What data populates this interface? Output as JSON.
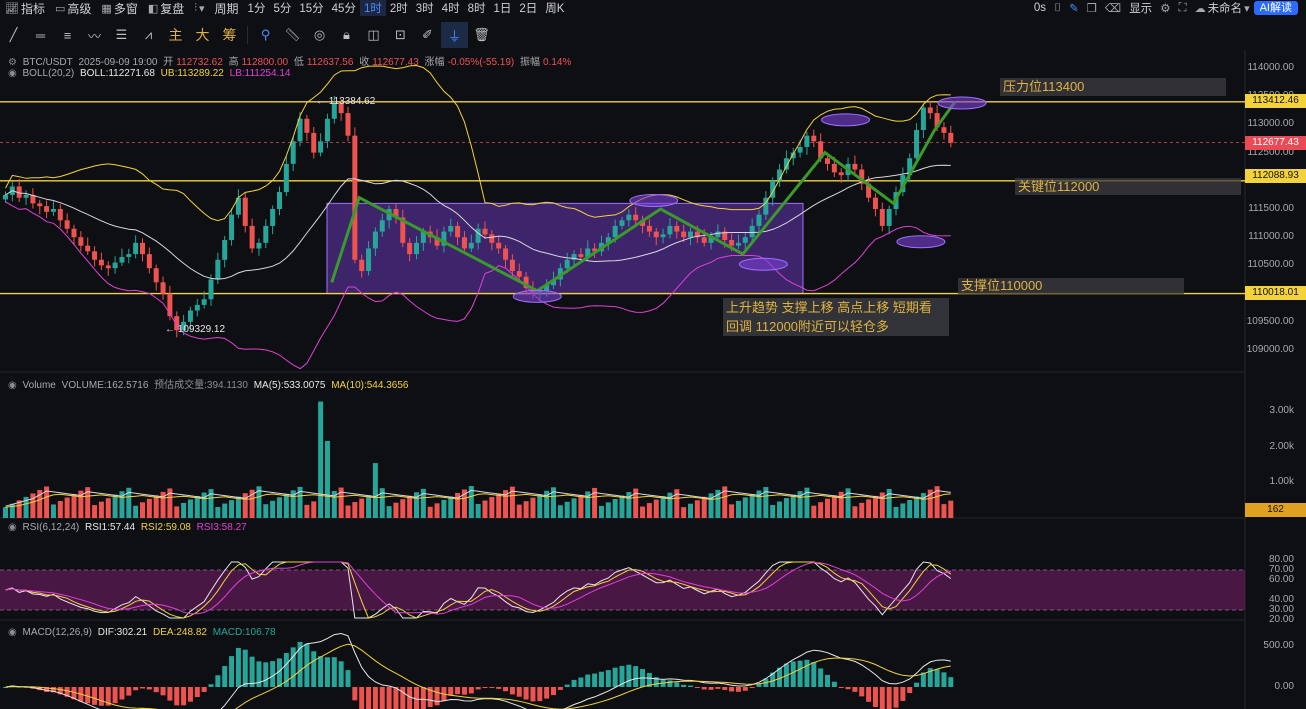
{
  "toolbar": {
    "indicators": "指标",
    "advanced": "高级",
    "multi_window": "多窗",
    "replay": "复盘",
    "period": "周期",
    "timeframes": [
      "1分",
      "5分",
      "15分",
      "45分",
      "1时",
      "2时",
      "3时",
      "4时",
      "8时",
      "1日",
      "2日",
      "周K"
    ],
    "active_timeframe": "1时",
    "countdown": "0s",
    "display": "显示",
    "layout_name": "未命名",
    "ai_button": "AI解读"
  },
  "draw_tools": [
    "主",
    "大",
    "筹"
  ],
  "info": {
    "symbol": "BTC/USDT",
    "datetime": "2025-09-09 19:00",
    "open_label": "开",
    "open": "112732.62",
    "high_label": "高",
    "high": "112800.00",
    "low_label": "低",
    "low": "112637.56",
    "close_label": "收",
    "close": "112677.43",
    "change_label": "涨幅",
    "change": "-0.05%(-55.19)",
    "amp_label": "振幅",
    "amp": "0.14%"
  },
  "boll": {
    "name": "BOLL(20,2)",
    "mid": "BOLL:112271.68",
    "ub": "UB:113289.22",
    "lb": "LB:111254.14"
  },
  "volume": {
    "name": "Volume",
    "vol": "VOLUME:162.5716",
    "est": "预估成交量:394.1130",
    "ma5": "MA(5):533.0075",
    "ma10": "MA(10):544.3656",
    "tag": "162"
  },
  "rsi": {
    "name": "RSI(6,12,24)",
    "r1": "RSI1:57.44",
    "r2": "RSI2:59.08",
    "r3": "RSI3:58.27"
  },
  "macd": {
    "name": "MACD(12,26,9)",
    "dif": "DIF:302.21",
    "dea": "DEA:248.82",
    "macd": "MACD:106.78"
  },
  "price_axis": [
    "114000.00",
    "113500.00",
    "113000.00",
    "112500.00",
    "112000.00",
    "111500.00",
    "111000.00",
    "110500.00",
    "110000.00",
    "109500.00",
    "109000.00"
  ],
  "price_tags": {
    "resistance": "113412.46",
    "current": "112677.43",
    "key": "112088.93",
    "support": "110018.01"
  },
  "volume_axis": [
    "3.00k",
    "2.00k",
    "1.00k"
  ],
  "rsi_axis": [
    "80.00",
    "70.00",
    "60.00",
    "40.00",
    "30.00",
    "20.00"
  ],
  "macd_axis": [
    "500.00",
    "0.00"
  ],
  "chart_marks": {
    "high": "113384.62",
    "low": "109329.12"
  },
  "annotations": {
    "resistance": "压力位113400",
    "key": "关键位112000",
    "support": "支撑位110000",
    "note_line1": "上升趋势 支撑上移 高点上移 短期看",
    "note_line2": "回调  112000附近可以轻仓多"
  },
  "colors": {
    "up": "#26a69a",
    "down": "#ef5350",
    "yellow": "#f3d23b",
    "magenta": "#e040d8",
    "accent": "#2c6bff",
    "purple_box": "#7b3fd6",
    "trend": "#3a9a2a"
  },
  "chart_data": {
    "type": "candlestick",
    "symbol": "BTC/USDT",
    "interval": "1h",
    "ylim": [
      109000,
      114000
    ],
    "levels": {
      "resistance": 113400,
      "key": 112000,
      "support": 110000
    },
    "closes": [
      111750,
      111900,
      111700,
      111750,
      111600,
      111550,
      111450,
      111500,
      111300,
      111150,
      111000,
      110850,
      110750,
      110600,
      110500,
      110450,
      110550,
      110650,
      110700,
      110900,
      110700,
      110450,
      110200,
      110000,
      109600,
      109350,
      109500,
      109700,
      109800,
      109900,
      110250,
      110600,
      110950,
      111400,
      111700,
      111200,
      110800,
      110900,
      111200,
      111500,
      111800,
      112300,
      112700,
      113100,
      112850,
      112500,
      112700,
      113100,
      113380,
      113200,
      112800,
      110600,
      110400,
      110800,
      111100,
      111300,
      111500,
      111350,
      110900,
      110700,
      110900,
      111100,
      111000,
      110850,
      111100,
      111200,
      111000,
      110800,
      110900,
      111150,
      111050,
      110900,
      110800,
      110600,
      110400,
      110300,
      110100,
      110000,
      110050,
      110150,
      110250,
      110450,
      110600,
      110700,
      110650,
      110800,
      110750,
      110900,
      111000,
      111200,
      111300,
      111400,
      111300,
      111200,
      111100,
      111000,
      111050,
      111200,
      111100,
      111000,
      111100,
      111000,
      110900,
      111000,
      111100,
      110950,
      110850,
      110900,
      111000,
      111200,
      111400,
      111700,
      112000,
      112200,
      112400,
      112500,
      112600,
      112800,
      112700,
      112400,
      112300,
      112150,
      112100,
      112300,
      112200,
      111950,
      111700,
      111500,
      111200,
      111500,
      111800,
      112100,
      112400,
      112900,
      113300,
      113200,
      112950,
      112850,
      112677
    ]
  }
}
